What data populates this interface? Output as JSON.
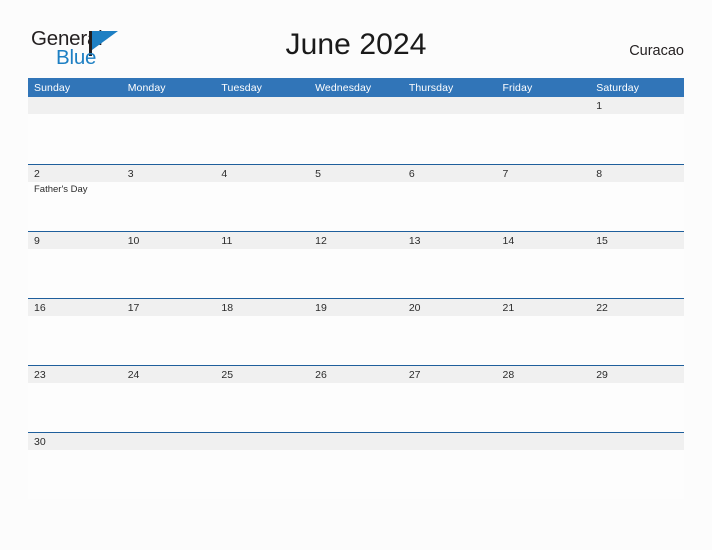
{
  "brand": {
    "name_part1": "General",
    "name_part2": "Blue",
    "colors": {
      "text_dark": "#231f20",
      "accent_blue": "#1d7fc3"
    }
  },
  "header": {
    "title": "June 2024",
    "country": "Curacao"
  },
  "calendar": {
    "month": "June",
    "year": "2024",
    "colors": {
      "header_bar": "#3175b8",
      "row_divider": "#1f5f9c",
      "date_band": "#f0f0f0",
      "page_background": "#fcfcfc"
    },
    "day_headers": [
      "Sunday",
      "Monday",
      "Tuesday",
      "Wednesday",
      "Thursday",
      "Friday",
      "Saturday"
    ],
    "weeks": [
      {
        "days": [
          {
            "date": "",
            "events": []
          },
          {
            "date": "",
            "events": []
          },
          {
            "date": "",
            "events": []
          },
          {
            "date": "",
            "events": []
          },
          {
            "date": "",
            "events": []
          },
          {
            "date": "",
            "events": []
          },
          {
            "date": "1",
            "events": []
          }
        ]
      },
      {
        "days": [
          {
            "date": "2",
            "events": [
              "Father's Day"
            ]
          },
          {
            "date": "3",
            "events": []
          },
          {
            "date": "4",
            "events": []
          },
          {
            "date": "5",
            "events": []
          },
          {
            "date": "6",
            "events": []
          },
          {
            "date": "7",
            "events": []
          },
          {
            "date": "8",
            "events": []
          }
        ]
      },
      {
        "days": [
          {
            "date": "9",
            "events": []
          },
          {
            "date": "10",
            "events": []
          },
          {
            "date": "11",
            "events": []
          },
          {
            "date": "12",
            "events": []
          },
          {
            "date": "13",
            "events": []
          },
          {
            "date": "14",
            "events": []
          },
          {
            "date": "15",
            "events": []
          }
        ]
      },
      {
        "days": [
          {
            "date": "16",
            "events": []
          },
          {
            "date": "17",
            "events": []
          },
          {
            "date": "18",
            "events": []
          },
          {
            "date": "19",
            "events": []
          },
          {
            "date": "20",
            "events": []
          },
          {
            "date": "21",
            "events": []
          },
          {
            "date": "22",
            "events": []
          }
        ]
      },
      {
        "days": [
          {
            "date": "23",
            "events": []
          },
          {
            "date": "24",
            "events": []
          },
          {
            "date": "25",
            "events": []
          },
          {
            "date": "26",
            "events": []
          },
          {
            "date": "27",
            "events": []
          },
          {
            "date": "28",
            "events": []
          },
          {
            "date": "29",
            "events": []
          }
        ]
      },
      {
        "days": [
          {
            "date": "30",
            "events": []
          },
          {
            "date": "",
            "events": []
          },
          {
            "date": "",
            "events": []
          },
          {
            "date": "",
            "events": []
          },
          {
            "date": "",
            "events": []
          },
          {
            "date": "",
            "events": []
          },
          {
            "date": "",
            "events": []
          }
        ]
      }
    ]
  }
}
